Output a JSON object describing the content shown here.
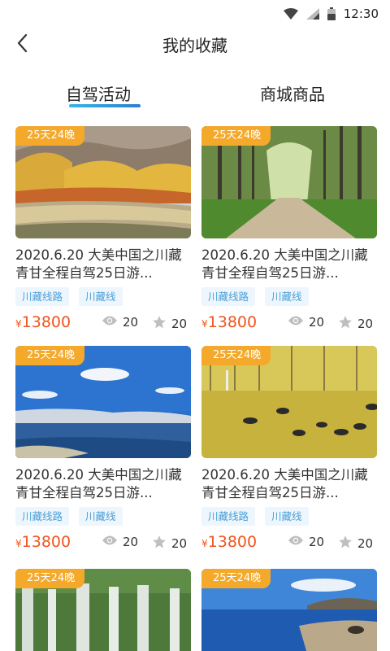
{
  "status_bar": {
    "time": "12:30"
  },
  "header": {
    "title": "我的收藏"
  },
  "tabs": {
    "active": "自驾活动",
    "other": "商城商品"
  },
  "cards": [
    {
      "badge": "25天24晚",
      "title": "2020.6.20   大美中国之川藏青甘全程自驾25日游...",
      "tags": [
        "川藏线路",
        "川藏线"
      ],
      "currency": "¥",
      "price": "13800",
      "views": "20",
      "stars": "20",
      "image": "autumn-river"
    },
    {
      "badge": "25天24晚",
      "title": "2020.6.20   大美中国之川藏青甘全程自驾25日游...",
      "tags": [
        "川藏线路",
        "川藏线"
      ],
      "currency": "¥",
      "price": "13800",
      "views": "20",
      "stars": "20",
      "image": "tree-lined-road"
    },
    {
      "badge": "25天24晚",
      "title": "2020.6.20   大美中国之川藏青甘全程自驾25日游...",
      "tags": [
        "川藏线路",
        "川藏线"
      ],
      "currency": "¥",
      "price": "13800",
      "views": "20",
      "stars": "20",
      "image": "lake-sky"
    },
    {
      "badge": "25天24晚",
      "title": "2020.6.20   大美中国之川藏青甘全程自驾25日游...",
      "tags": [
        "川藏线路",
        "川藏线"
      ],
      "currency": "¥",
      "price": "13800",
      "views": "20",
      "stars": "20",
      "image": "yak-meadow"
    },
    {
      "badge": "25天24晚",
      "image": "waterfall"
    },
    {
      "badge": "25天24晚",
      "image": "blue-lake-shore"
    }
  ]
}
